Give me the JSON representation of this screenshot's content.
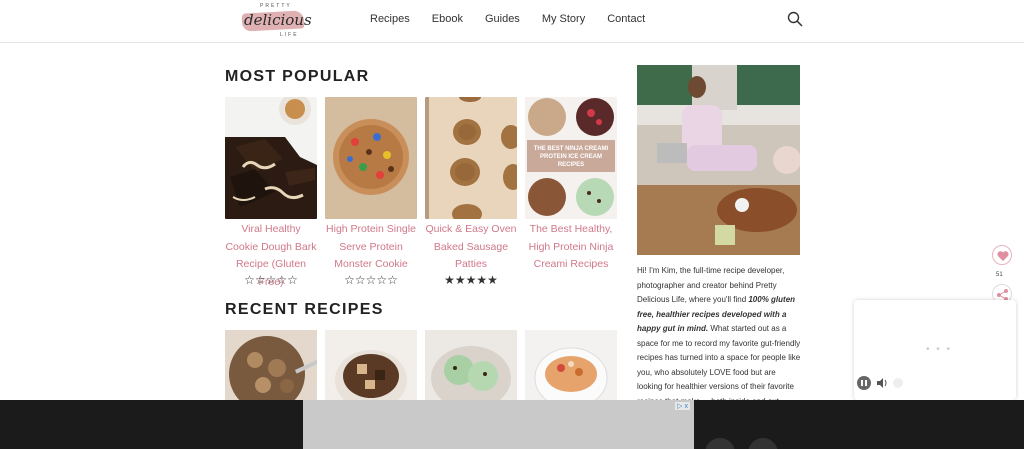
{
  "header": {
    "logo": {
      "top": "PRETTY",
      "script": "delicious",
      "bottom": "LIFE"
    },
    "nav": [
      "Recipes",
      "Ebook",
      "Guides",
      "My Story",
      "Contact"
    ]
  },
  "most_popular": {
    "title": "MOST POPULAR",
    "cards": [
      {
        "title": "Viral Healthy Cookie Dough Bark Recipe (Gluten Free)",
        "rating": 0,
        "stars": "☆☆☆☆☆"
      },
      {
        "title": "High Protein Single Serve Protein Monster Cookie",
        "rating": 0,
        "stars": "☆☆☆☆☆"
      },
      {
        "title": "Quick & Easy Oven Baked Sausage Patties",
        "rating": 5,
        "stars": "★★★★★"
      },
      {
        "title": "The Best Healthy, High Protein Ninja Creami Recipes",
        "rating": null,
        "stars": ""
      }
    ],
    "card4_overlay": "THE BEST NINJA CREAMI PROTEIN ICE CREAM RECIPES"
  },
  "recent_recipes": {
    "title": "RECENT RECIPES"
  },
  "sidebar": {
    "bio_pre": "Hi! I'm Kim, the full-time recipe developer, photographer and creator behind Pretty Delicious Life, where you'll find ",
    "bio_bold": "100% gluten free, healthier recipes developed with a happy gut in mind.",
    "bio_post": " What started out as a space for me to record my favorite gut-friendly recipes has turned into a space for people like you, who absolutely LOVE food but are looking for healthier versions of their favorite recipes that make ... both inside and out."
  },
  "share": {
    "count": "51"
  },
  "colors": {
    "accent": "#d0788a",
    "ad_bg": "#1b1b1b"
  }
}
